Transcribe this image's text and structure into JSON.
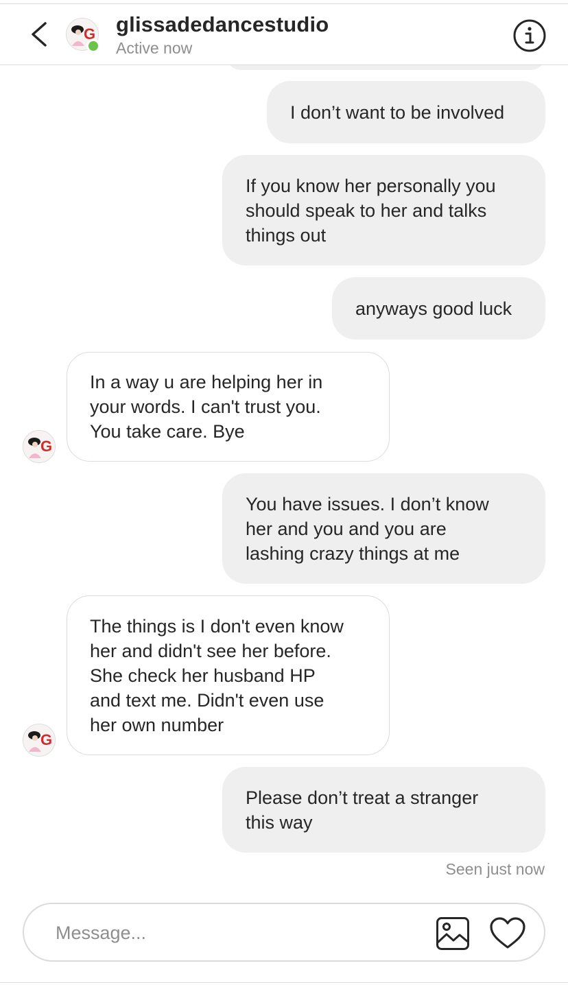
{
  "header": {
    "name": "glissadedancestudio",
    "status": "Active now"
  },
  "messages": [
    {
      "from": "me",
      "text": "I don’t want to be involved"
    },
    {
      "from": "me",
      "text": "If you know her personally you\nshould speak to her and talks\nthings out"
    },
    {
      "from": "me",
      "text": "anyways good luck"
    },
    {
      "from": "them",
      "text": "In a way u are helping her in\nyour words. I can't trust you.\nYou take care. Bye"
    },
    {
      "from": "me",
      "text": "You have issues. I don’t know\nher and you and you are\nlashing crazy things at me"
    },
    {
      "from": "them",
      "text": "The things is I don't even know\nher and didn't see her before.\nShe check her husband HP\nand text me. Didn't even use\nher own number"
    },
    {
      "from": "me",
      "text": "Please don’t treat a stranger\nthis way"
    }
  ],
  "seen_status": "Seen just now",
  "composer": {
    "placeholder": "Message..."
  },
  "icons": {
    "back": "chevron-left-icon",
    "info": "info-icon",
    "gallery": "image-icon",
    "like": "heart-icon"
  },
  "colors": {
    "my_bubble": "#efefef",
    "their_bubble_border": "#dbdbdb",
    "online": "#6cc24a",
    "muted_text": "#8e8e8e"
  }
}
